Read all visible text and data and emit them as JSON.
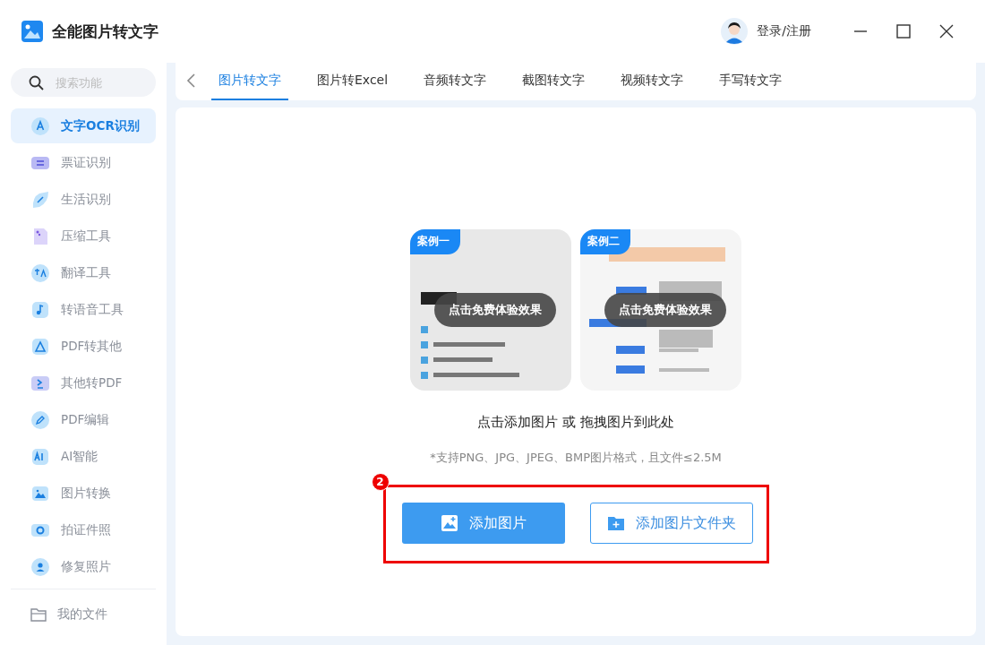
{
  "window": {
    "title": "全能图片转文字",
    "user": "登录/注册"
  },
  "sidebar": {
    "search": {
      "placeholder": "搜索功能"
    },
    "items": [
      {
        "label": "文字OCR识别",
        "selected": true
      },
      {
        "label": "票证识别",
        "selected": false
      },
      {
        "label": "生活识别",
        "selected": false
      },
      {
        "label": "压缩工具",
        "selected": false
      },
      {
        "label": "翻译工具",
        "selected": false
      },
      {
        "label": "转语音工具",
        "selected": false
      },
      {
        "label": "PDF转其他",
        "selected": false
      },
      {
        "label": "其他转PDF",
        "selected": false
      },
      {
        "label": "PDF编辑",
        "selected": false
      },
      {
        "label": "AI智能",
        "selected": false
      },
      {
        "label": "图片转换",
        "selected": false
      },
      {
        "label": "拍证件照",
        "selected": false
      },
      {
        "label": "修复照片",
        "selected": false
      }
    ],
    "footer": "我的文件"
  },
  "tabs": [
    {
      "label": "图片转文字",
      "selected": true
    },
    {
      "label": "图片转Excel",
      "selected": false
    },
    {
      "label": "音频转文字",
      "selected": false
    },
    {
      "label": "截图转文字",
      "selected": false
    },
    {
      "label": "视频转文字",
      "selected": false
    },
    {
      "label": "手写转文字",
      "selected": false
    }
  ],
  "examples": [
    {
      "badge": "案例一",
      "action": "点击免费体验效果",
      "kind": "card"
    },
    {
      "badge": "案例二",
      "action": "点击免费体验效果",
      "kind": "sheet"
    }
  ],
  "hint": "点击添加图片 或 拖拽图片到此处",
  "formats": "*支持PNG、JPG、JPEG、BMP图片格式，且文件≤2.5M",
  "annotation": {
    "number": "2"
  },
  "buttons": [
    {
      "label": "添加图片",
      "kind": "primary"
    },
    {
      "label": "添加图片文件夹",
      "kind": "outline"
    }
  ]
}
